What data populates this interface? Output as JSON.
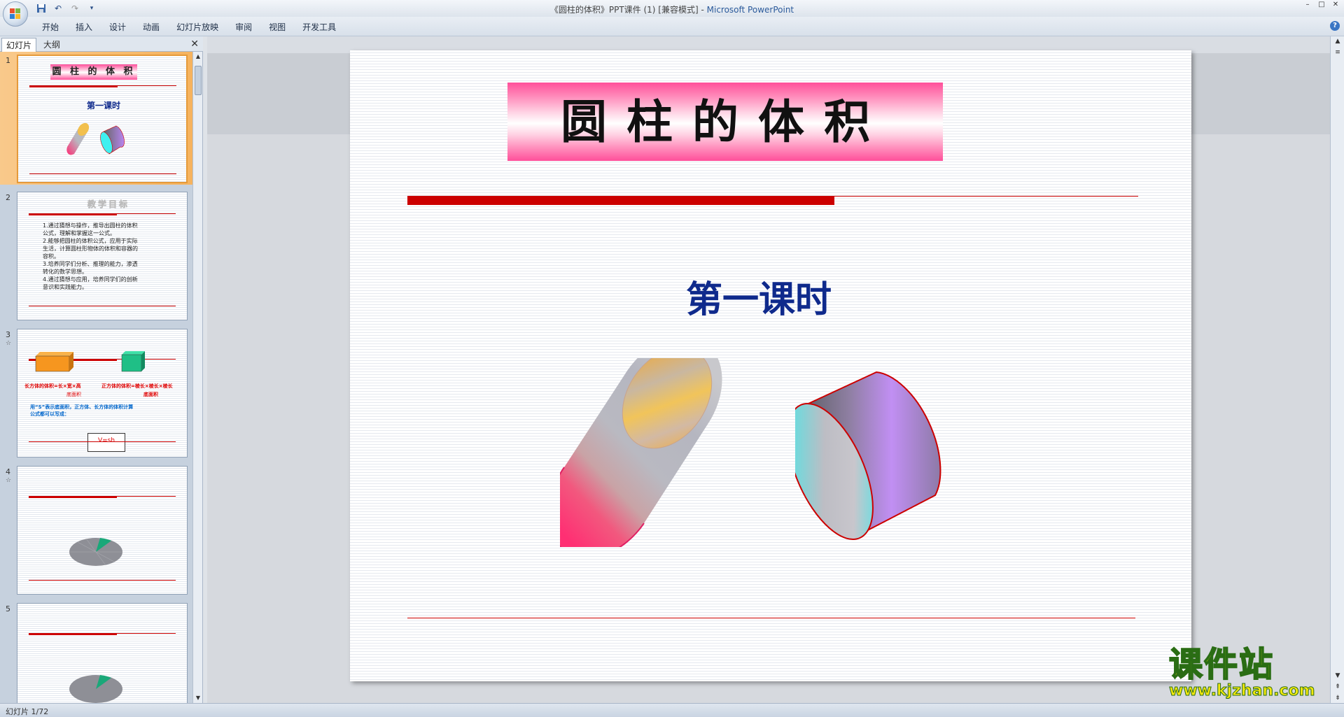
{
  "window": {
    "title": "《圆柱的体积》PPT课件 (1) [兼容模式]",
    "title_sep": " - ",
    "app_name": "Microsoft PowerPoint"
  },
  "ribbon": {
    "tabs": [
      "开始",
      "插入",
      "设计",
      "动画",
      "幻灯片放映",
      "审阅",
      "视图",
      "开发工具"
    ]
  },
  "left_pane": {
    "tab_slides": "幻灯片",
    "tab_outline": "大纲"
  },
  "thumbnails": [
    {
      "number": "1",
      "title": "圆 柱 的 体 积",
      "subtitle": "第一课时"
    },
    {
      "number": "2",
      "title": "教学目标",
      "lines": [
        "1.通过猜想与操作，推导出圆柱的体积",
        "公式，理解和掌握这一公式。",
        "2.能够把圆柱的体积公式，应用于实际",
        "生活，计算圆柱形物体的体积和容器的",
        "容积。",
        "3.培养同学们分析、推理的能力，渗透",
        "转化的数学思想。",
        "4.通过猜想与应用，培养同学们的创新",
        "意识和实践能力。"
      ]
    },
    {
      "number": "3",
      "star": "☆",
      "formula_left": "长方体的体积=长×宽×高",
      "formula_right": "正方体的体积=棱长×棱长×棱长",
      "label_left": "底面积",
      "label_right": "底面积",
      "note": "用“S”表示底面积，正方体、长方体的体积计算",
      "note2": "公式都可以写成：",
      "box": "V=sh"
    },
    {
      "number": "4",
      "star": "☆"
    },
    {
      "number": "5"
    }
  ],
  "slide": {
    "title": "圆柱的体积",
    "subtitle": "第一课时"
  },
  "watermark": {
    "brand": "课件站",
    "url": "www.kjzhan.com"
  },
  "status": {
    "text": "幻灯片 1/72"
  }
}
